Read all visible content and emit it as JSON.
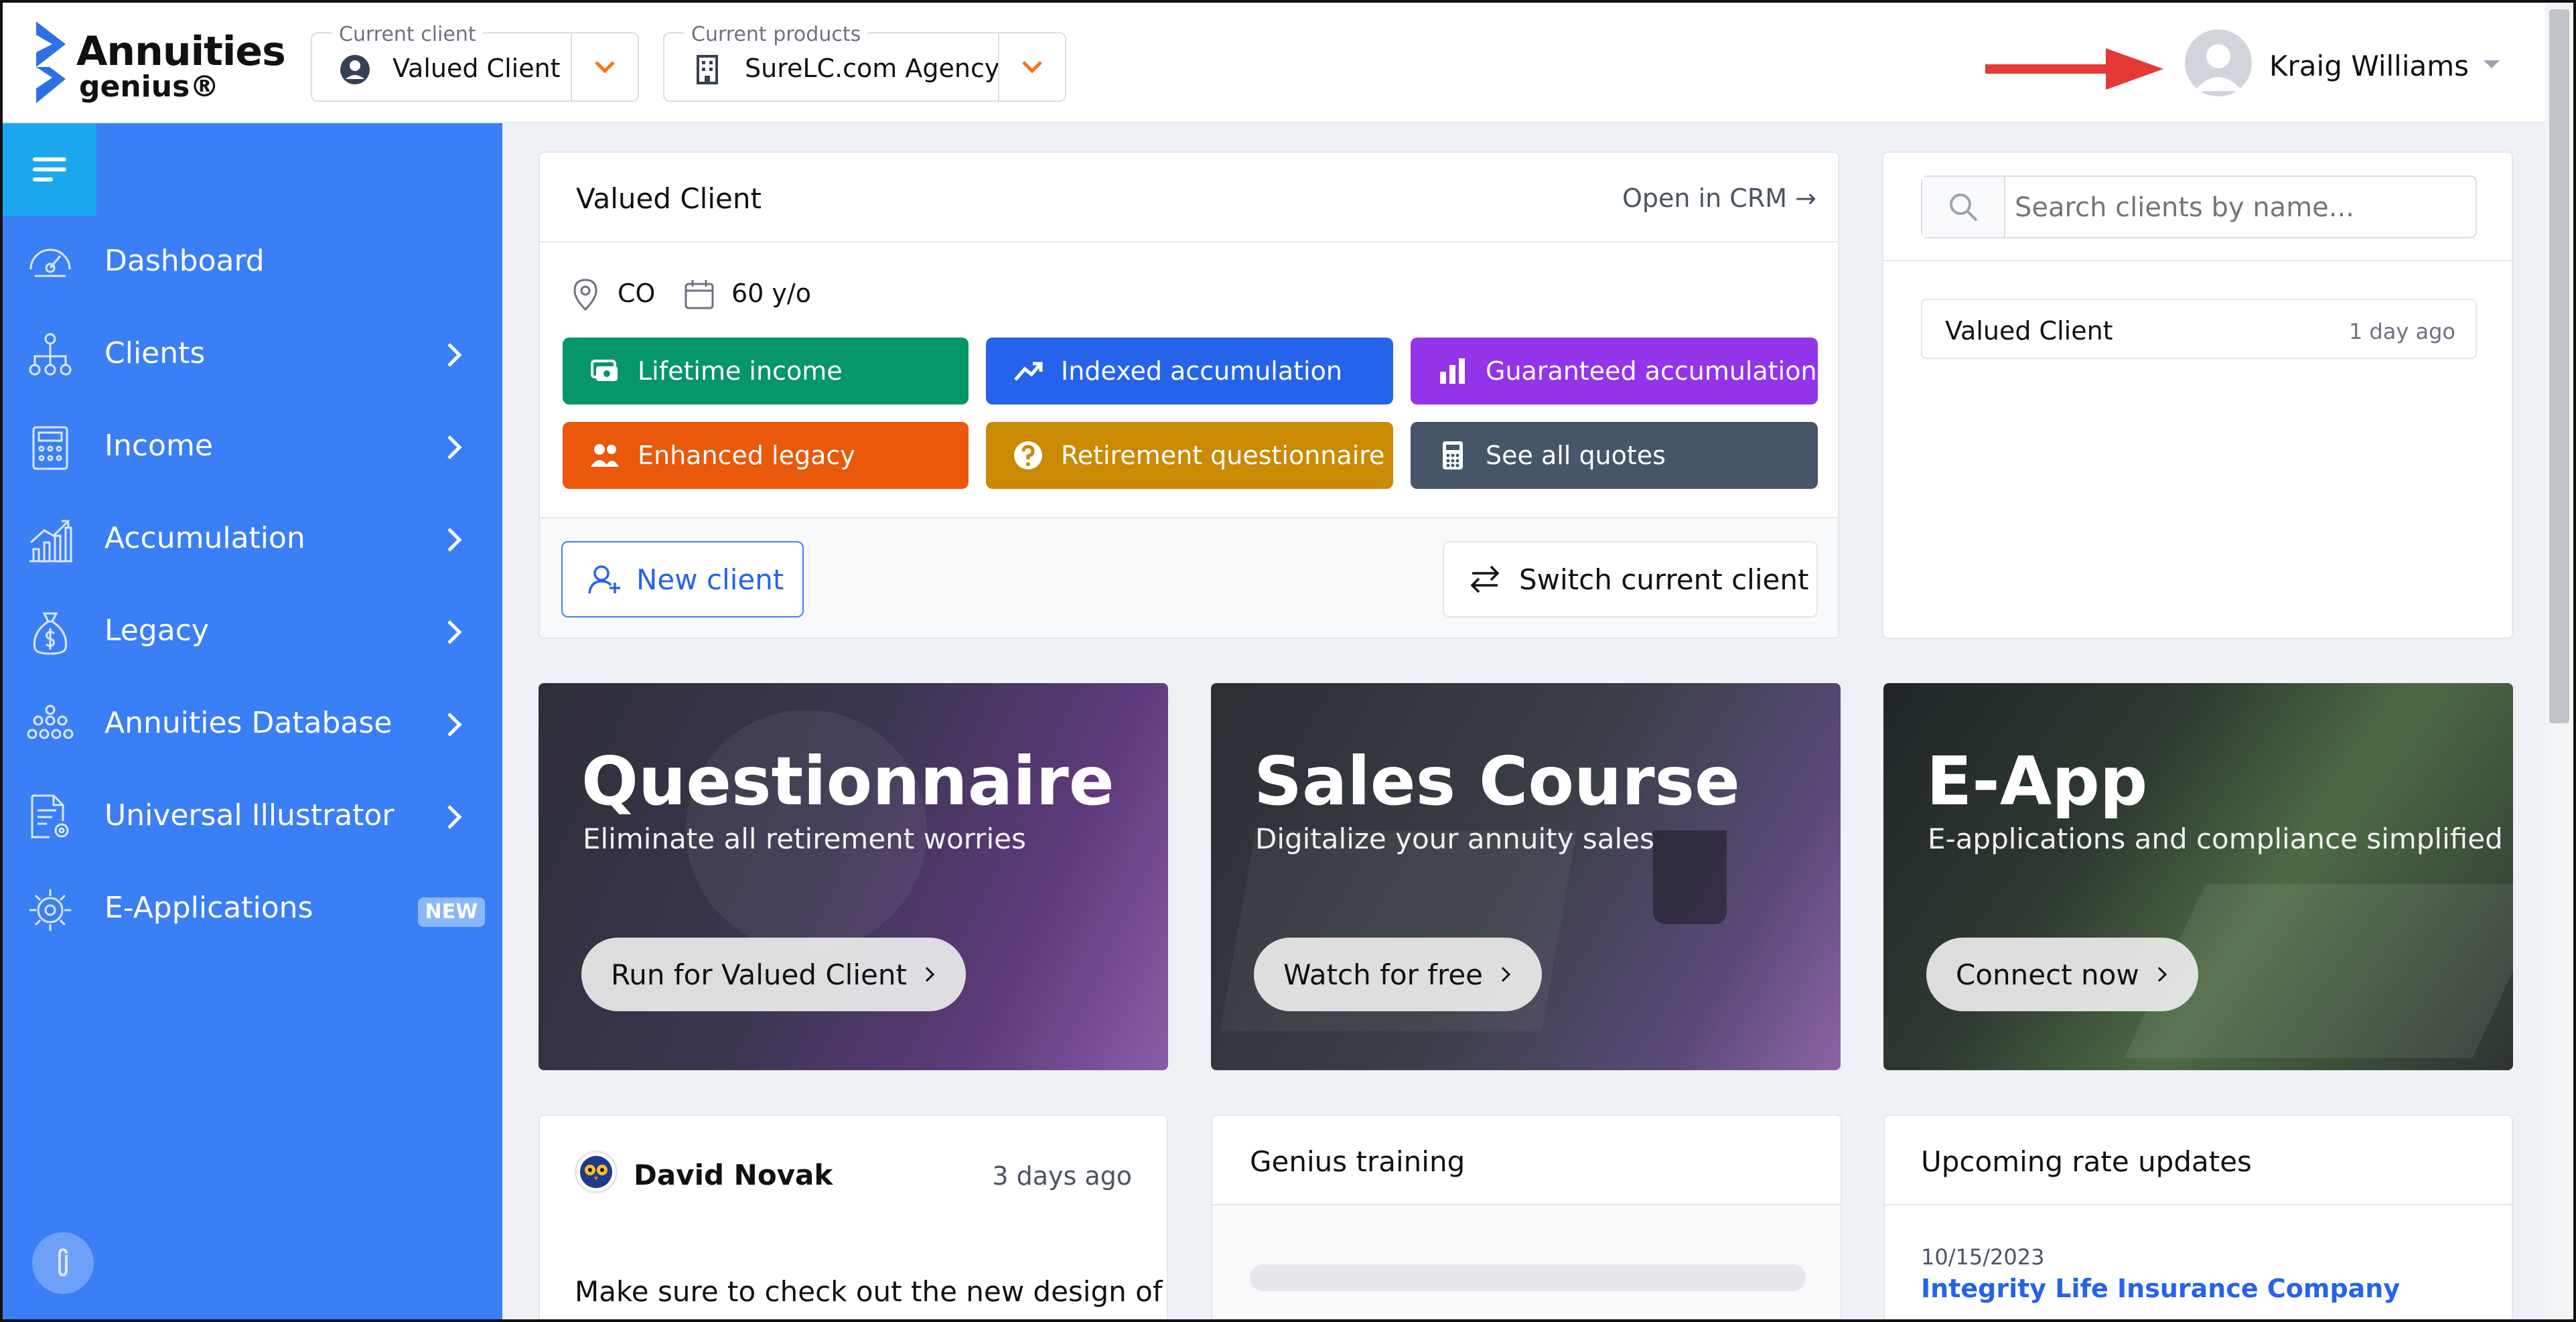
{
  "header": {
    "brand_line1": "Annuities",
    "brand_line2": "genius®",
    "client_selector": {
      "label": "Current client",
      "value": "Valued Client",
      "icon": "user-circle-icon"
    },
    "products_selector": {
      "label": "Current products",
      "value": "SureLC.com Agency",
      "icon": "building-icon"
    },
    "user_name": "Kraig Williams",
    "accent_color": "#f97316"
  },
  "sidebar": {
    "color": "#3b7ff6",
    "items": [
      {
        "label": "Dashboard",
        "icon": "gauge-icon",
        "has_chevron": false
      },
      {
        "label": "Clients",
        "icon": "hierarchy-icon",
        "has_chevron": true
      },
      {
        "label": "Income",
        "icon": "calculator-icon",
        "has_chevron": true
      },
      {
        "label": "Accumulation",
        "icon": "growth-chart-icon",
        "has_chevron": true
      },
      {
        "label": "Legacy",
        "icon": "money-bag-icon",
        "has_chevron": true
      },
      {
        "label": "Annuities Database",
        "icon": "database-dots-icon",
        "has_chevron": true
      },
      {
        "label": "Universal Illustrator",
        "icon": "document-gear-icon",
        "has_chevron": true
      },
      {
        "label": "E-Applications",
        "icon": "gear-network-icon",
        "has_chevron": false,
        "badge": "NEW"
      }
    ]
  },
  "client_card": {
    "title": "Valued Client",
    "crm_link": "Open in CRM →",
    "state": "CO",
    "age": "60 y/o",
    "actions": [
      {
        "label": "Lifetime income",
        "color": "#059669",
        "icon": "money-stack-icon"
      },
      {
        "label": "Indexed accumulation",
        "color": "#2563eb",
        "icon": "trend-up-icon"
      },
      {
        "label": "Guaranteed accumulation",
        "color": "#9333ea",
        "icon": "bar-chart-icon"
      },
      {
        "label": "Enhanced legacy",
        "color": "#ea580c",
        "icon": "users-icon"
      },
      {
        "label": "Retirement questionnaire",
        "color": "#ca8a04",
        "icon": "question-circle-icon"
      },
      {
        "label": "See all quotes",
        "color": "#475569",
        "icon": "calculator-icon"
      }
    ],
    "new_client_label": "New client",
    "switch_client_label": "Switch current client"
  },
  "search_panel": {
    "placeholder": "Search clients by name...",
    "recent": [
      {
        "name": "Valued Client",
        "time": "1 day ago"
      }
    ]
  },
  "promos": [
    {
      "title": "Questionnaire",
      "subtitle": "Eliminate all retirement worries",
      "button": "Run for Valued Client"
    },
    {
      "title": "Sales Course",
      "subtitle": "Digitalize your annuity sales",
      "button": "Watch for free"
    },
    {
      "title": "E-App",
      "subtitle": "E-applications and compliance simplified",
      "button": "Connect now"
    }
  ],
  "news": {
    "author": "David Novak",
    "time": "3 days ago",
    "text": "Make sure to check out the new design of"
  },
  "training": {
    "title": "Genius training"
  },
  "rates": {
    "title": "Upcoming rate updates",
    "date": "10/15/2023",
    "company": "Integrity Life Insurance Company"
  }
}
